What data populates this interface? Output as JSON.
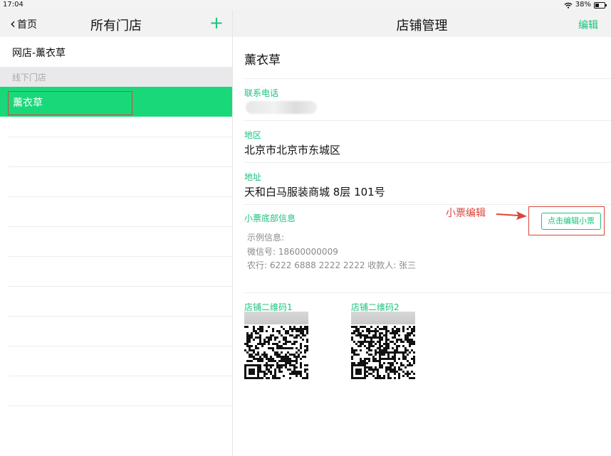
{
  "status_bar": {
    "time": "17:04",
    "battery": "38%"
  },
  "left": {
    "back_label": "首页",
    "title": "所有门店",
    "add_label": "+",
    "online_store": "网店-薰衣草",
    "section_offline": "线下门店",
    "selected_store": "薰衣草"
  },
  "right": {
    "title": "店铺管理",
    "edit_label": "编辑",
    "store_name": "薰衣草",
    "phone_label": "联系电话",
    "region_label": "地区",
    "region_value": "北京市北京市东城区",
    "address_label": "地址",
    "address_value": "天和白马服装商城 8层 101号",
    "receipt_label": "小票底部信息",
    "receipt_lines": [
      "示例信息:",
      "微信号: 18600000009",
      "农行: 6222 6888 2222 2222   收款人: 张三"
    ],
    "receipt_button": "点击编辑小票",
    "annotation": "小票编辑",
    "qr1_label": "店铺二维码1",
    "qr2_label": "店铺二维码2"
  },
  "colors": {
    "accent": "#19c37d",
    "selected_row": "#19d879",
    "annotation": "#d8453b"
  },
  "icons": {
    "back": "chevron-left-icon",
    "add": "plus-icon",
    "wifi": "wifi-icon",
    "battery": "battery-icon",
    "annotation_arrow": "arrow-right-icon"
  }
}
